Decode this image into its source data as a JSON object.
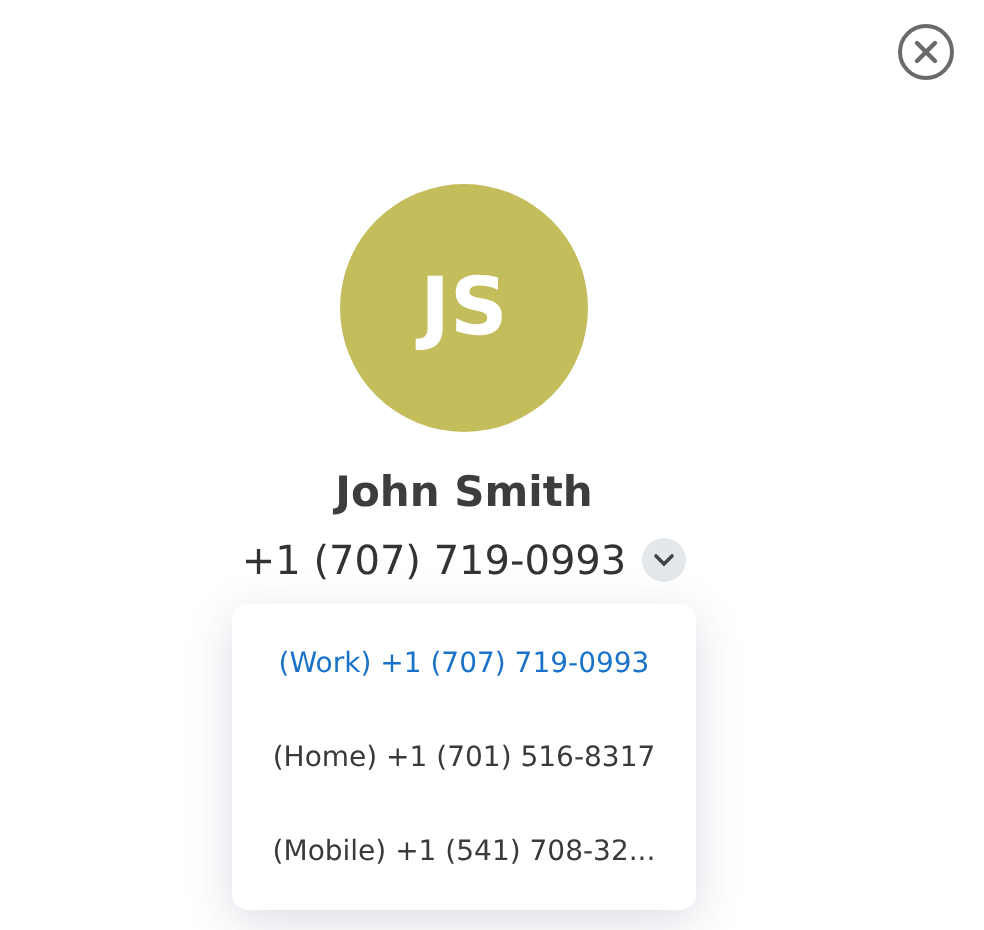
{
  "contact": {
    "initials": "JS",
    "name": "John Smith",
    "phone": "+1 (707) 719-0993"
  },
  "phone_menu": {
    "expanded": true,
    "items": [
      {
        "label": "(Work) +1 (707) 719-0993",
        "selected": true
      },
      {
        "label": "(Home) +1 (701) 516-8317",
        "selected": false
      },
      {
        "label": "(Mobile) +1 (541) 708-32...",
        "selected": false
      }
    ]
  }
}
